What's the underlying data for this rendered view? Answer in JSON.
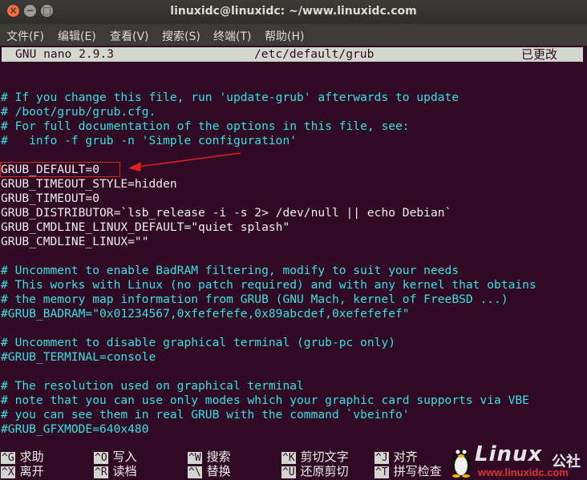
{
  "window": {
    "title": "linuxidc@linuxidc: ~/www.linuxidc.com",
    "close_glyph": "×",
    "min_glyph": "−",
    "max_glyph": "□"
  },
  "menubar": [
    {
      "label": "文件(F)"
    },
    {
      "label": "编辑(E)"
    },
    {
      "label": "查看(V)"
    },
    {
      "label": "搜索(S)"
    },
    {
      "label": "终端(T)"
    },
    {
      "label": "帮助(H)"
    }
  ],
  "nano": {
    "version": "GNU nano 2.9.3",
    "filename": "/etc/default/grub",
    "modified": "已更改"
  },
  "file_lines": [
    {
      "text": "",
      "kind": "c"
    },
    {
      "text": "# If you change this file, run 'update-grub' afterwards to update",
      "kind": "c"
    },
    {
      "text": "# /boot/grub/grub.cfg.",
      "kind": "c"
    },
    {
      "text": "# For full documentation of the options in this file, see:",
      "kind": "c"
    },
    {
      "text": "#   info -f grub -n 'Simple configuration'",
      "kind": "c"
    },
    {
      "text": "",
      "kind": "c"
    },
    {
      "text": "GRUB_DEFAULT=0",
      "kind": "w"
    },
    {
      "text": "GRUB_TIMEOUT_STYLE=hidden",
      "kind": "w"
    },
    {
      "text": "GRUB_TIMEOUT=0",
      "kind": "w"
    },
    {
      "text": "GRUB_DISTRIBUTOR=`lsb_release -i -s 2> /dev/null || echo Debian`",
      "kind": "w"
    },
    {
      "text": "GRUB_CMDLINE_LINUX_DEFAULT=\"quiet splash\"",
      "kind": "w"
    },
    {
      "text": "GRUB_CMDLINE_LINUX=\"\"",
      "kind": "w"
    },
    {
      "text": "",
      "kind": "c"
    },
    {
      "text": "# Uncomment to enable BadRAM filtering, modify to suit your needs",
      "kind": "c"
    },
    {
      "text": "# This works with Linux (no patch required) and with any kernel that obtains",
      "kind": "c"
    },
    {
      "text": "# the memory map information from GRUB (GNU Mach, kernel of FreeBSD ...)",
      "kind": "c"
    },
    {
      "text": "#GRUB_BADRAM=\"0x01234567,0xfefefefe,0x89abcdef,0xefefefef\"",
      "kind": "c"
    },
    {
      "text": "",
      "kind": "c"
    },
    {
      "text": "# Uncomment to disable graphical terminal (grub-pc only)",
      "kind": "c"
    },
    {
      "text": "#GRUB_TERMINAL=console",
      "kind": "c"
    },
    {
      "text": "",
      "kind": "c"
    },
    {
      "text": "# The resolution used on graphical terminal",
      "kind": "c"
    },
    {
      "text": "# note that you can use only modes which your graphic card supports via VBE",
      "kind": "c"
    },
    {
      "text": "# you can see them in real GRUB with the command `vbeinfo'",
      "kind": "c"
    },
    {
      "text": "#GRUB_GFXMODE=640x480",
      "kind": "c"
    }
  ],
  "shortcuts_row1": [
    {
      "key": "^G",
      "label": "求助"
    },
    {
      "key": "^O",
      "label": "写入"
    },
    {
      "key": "^W",
      "label": "搜索"
    },
    {
      "key": "^K",
      "label": "剪切文字"
    },
    {
      "key": "^J",
      "label": "对齐"
    }
  ],
  "shortcuts_row2": [
    {
      "key": "^X",
      "label": "离开"
    },
    {
      "key": "^R",
      "label": "读档"
    },
    {
      "key": "^\\",
      "label": "替换"
    },
    {
      "key": "^U",
      "label": "还原剪切"
    },
    {
      "key": "^T",
      "label": "拼写检查"
    }
  ],
  "watermark": {
    "word": "Linux",
    "cn": "公社",
    "url": "www.linuxidc.com"
  },
  "colors": {
    "terminal_bg": "#300a24",
    "comment": "#34e2e2",
    "text": "#eeeeec",
    "statusbar": "#d3d7cf",
    "annotation": "#e02020"
  }
}
